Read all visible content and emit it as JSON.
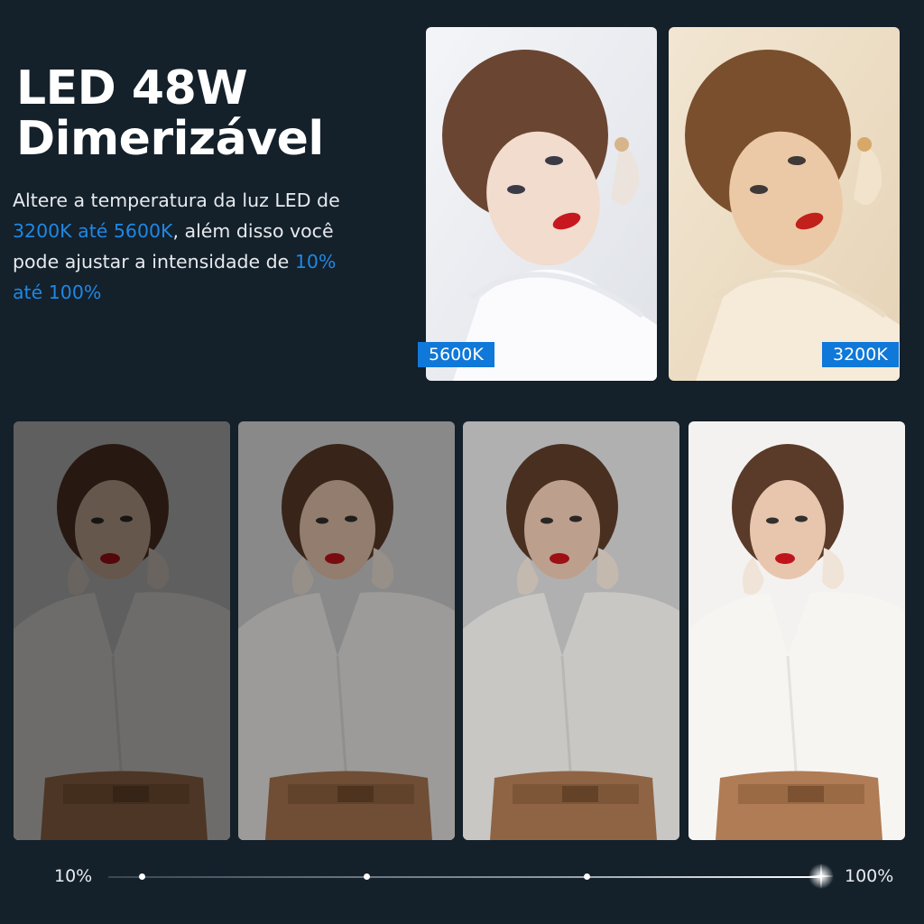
{
  "header": {
    "title_line1": "LED 48W",
    "title_line2": "Dimerizável"
  },
  "description": {
    "text1": "Altere a temperatura da luz LED de ",
    "range_temp": "3200K até 5600K",
    "text2": ", além disso você pode ajustar a intensidade de ",
    "range_intensity": "10% até 100%"
  },
  "temperature_photos": [
    {
      "label": "5600K"
    },
    {
      "label": "3200K"
    }
  ],
  "brightness_photos": [
    {
      "level": 0.1
    },
    {
      "level": 0.4
    },
    {
      "level": 0.7
    },
    {
      "level": 1.0
    }
  ],
  "slider": {
    "min_label": "10%",
    "max_label": "100%",
    "value": 1.0
  },
  "colors": {
    "background": "#14202a",
    "accent": "#1e88e5",
    "tag": "#0f78d8"
  }
}
